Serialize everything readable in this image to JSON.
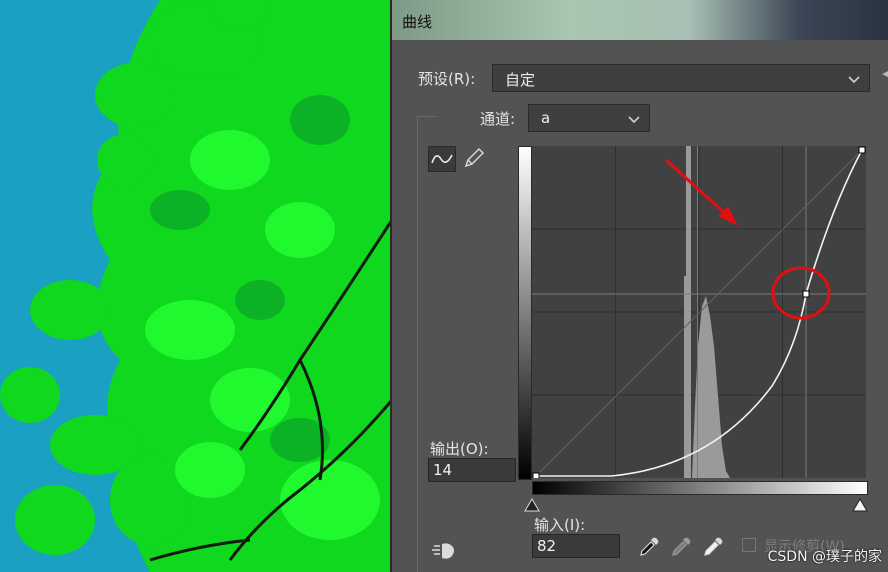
{
  "dialog": {
    "title": "曲线",
    "preset_label": "预设(R):",
    "preset_value": "自定",
    "channel_label": "通道:",
    "channel_value": "a",
    "output_label": "输出(O):",
    "output_value": "14",
    "input_label": "输入(I):",
    "input_value": "82",
    "show_clipping_label": "显示修剪(W)"
  },
  "watermark": "CSDN @璞子的家",
  "icons": {
    "curve_tool": "curve-tool-icon",
    "pencil_tool": "pencil-icon",
    "auto_adjust": "hand-pointer-icon",
    "black_eyedropper": "eyedropper-black-icon",
    "gray_eyedropper": "eyedropper-gray-icon",
    "white_eyedropper": "eyedropper-white-icon"
  },
  "colors": {
    "dialog_bg": "#535353",
    "accent_annotation": "#e01010",
    "foliage": "#10e020"
  }
}
